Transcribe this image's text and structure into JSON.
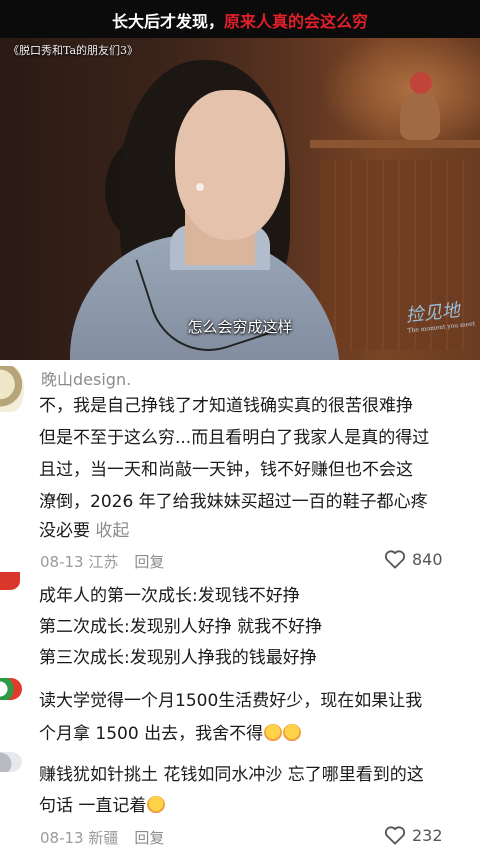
{
  "video": {
    "title_white": "长大后才发现，",
    "title_red": "原来人真的会这么穷",
    "show_name": "《脱口秀和Ta的朋友们3》",
    "subtitle": "怎么会穷成这样",
    "watermark": "捡见地",
    "watermark_small": "The moment you meet"
  },
  "comments": [
    {
      "username": "晚山design.",
      "lines": [
        "不，我是自己挣钱了才知道钱确实真的很苦很难挣",
        "但是不至于这么穷...而且看明白了我家人是真的得过",
        "且过，当一天和尚敲一天钟，钱不好赚但也不会这",
        "潦倒，2026 年了给我妹妹买超过一百的鞋子都心疼",
        "没必要 "
      ],
      "collapse_label": "收起",
      "date": "08-13",
      "location": "江苏",
      "reply_label": "回复",
      "likes": "840"
    },
    {
      "lines": [
        "成年人的第一次成长:发现钱不好挣",
        "第二次成长:发现别人好挣 就我不好挣",
        "第三次成长:发现别人挣我的钱最好挣"
      ]
    },
    {
      "lines": [
        "读大学觉得一个月1500生活费好少，现在如果让我",
        "个月拿 1500 出去，我舍不得"
      ]
    },
    {
      "lines": [
        "赚钱犹如针挑土 花钱如同水冲沙 忘了哪里看到的这",
        "句话 一直记着"
      ],
      "date": "08-13",
      "location": "新疆",
      "reply_label": "回复",
      "likes": "232"
    }
  ],
  "colors": {
    "accent_red": "#e0202a",
    "meta_gray": "#9a9a9a"
  }
}
